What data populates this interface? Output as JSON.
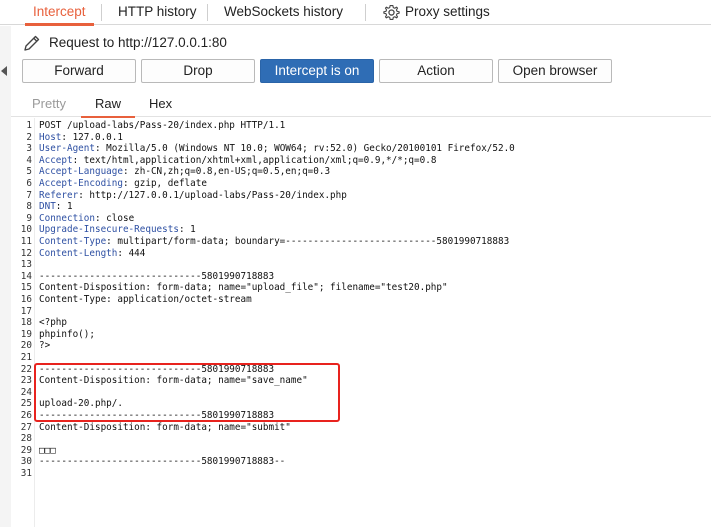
{
  "tabs": {
    "intercept": "Intercept",
    "http_history": "HTTP history",
    "websockets_history": "WebSockets history",
    "proxy_settings": "Proxy settings"
  },
  "request": {
    "label": "Request to http://127.0.0.1:80"
  },
  "buttons": {
    "forward": "Forward",
    "drop": "Drop",
    "intercept_toggle": "Intercept is on",
    "action": "Action",
    "open_browser": "Open browser"
  },
  "view_tabs": {
    "pretty": "Pretty",
    "raw": "Raw",
    "hex": "Hex",
    "selected": "Raw"
  },
  "colors": {
    "accent": "#e8603c",
    "primary_button": "#2f6db5",
    "header_key": "#2e50a3",
    "highlight": "#e8231e"
  },
  "editor": {
    "lines": [
      {
        "n": "1",
        "key": "",
        "val": "POST /upload-labs/Pass-20/index.php HTTP/1.1"
      },
      {
        "n": "2",
        "key": "Host",
        "val": ": 127.0.0.1"
      },
      {
        "n": "3",
        "key": "User-Agent",
        "val": ": Mozilla/5.0 (Windows NT 10.0; WOW64; rv:52.0) Gecko/20100101 Firefox/52.0"
      },
      {
        "n": "4",
        "key": "Accept",
        "val": ": text/html,application/xhtml+xml,application/xml;q=0.9,*/*;q=0.8"
      },
      {
        "n": "5",
        "key": "Accept-Language",
        "val": ": zh-CN,zh;q=0.8,en-US;q=0.5,en;q=0.3"
      },
      {
        "n": "6",
        "key": "Accept-Encoding",
        "val": ": gzip, deflate"
      },
      {
        "n": "7",
        "key": "Referer",
        "val": ": http://127.0.0.1/upload-labs/Pass-20/index.php"
      },
      {
        "n": "8",
        "key": "DNT",
        "val": ": 1"
      },
      {
        "n": "9",
        "key": "Connection",
        "val": ": close"
      },
      {
        "n": "10",
        "key": "Upgrade-Insecure-Requests",
        "val": ": 1"
      },
      {
        "n": "11",
        "key": "Content-Type",
        "val": ": multipart/form-data; boundary=---------------------------5801990718883"
      },
      {
        "n": "12",
        "key": "Content-Length",
        "val": ": 444"
      },
      {
        "n": "13",
        "key": "",
        "val": ""
      },
      {
        "n": "14",
        "key": "",
        "val": "-----------------------------5801990718883"
      },
      {
        "n": "15",
        "key": "",
        "val": "Content-Disposition: form-data; name=\"upload_file\"; filename=\"test20.php\""
      },
      {
        "n": "16",
        "key": "",
        "val": "Content-Type: application/octet-stream"
      },
      {
        "n": "17",
        "key": "",
        "val": ""
      },
      {
        "n": "18",
        "key": "",
        "val": "<?php"
      },
      {
        "n": "19",
        "key": "",
        "val": "phpinfo();"
      },
      {
        "n": "20",
        "key": "",
        "val": "?>"
      },
      {
        "n": "21",
        "key": "",
        "val": ""
      },
      {
        "n": "22",
        "key": "",
        "val": "-----------------------------5801990718883"
      },
      {
        "n": "23",
        "key": "",
        "val": "Content-Disposition: form-data; name=\"save_name\""
      },
      {
        "n": "24",
        "key": "",
        "val": ""
      },
      {
        "n": "25",
        "key": "",
        "val": "upload-20.php/."
      },
      {
        "n": "26",
        "key": "",
        "val": "-----------------------------5801990718883"
      },
      {
        "n": "27",
        "key": "",
        "val": "Content-Disposition: form-data; name=\"submit\""
      },
      {
        "n": "28",
        "key": "",
        "val": ""
      },
      {
        "n": "29",
        "key": "",
        "val": "□□□"
      },
      {
        "n": "30",
        "key": "",
        "val": "-----------------------------5801990718883--"
      },
      {
        "n": "31",
        "key": "",
        "val": ""
      }
    ]
  }
}
